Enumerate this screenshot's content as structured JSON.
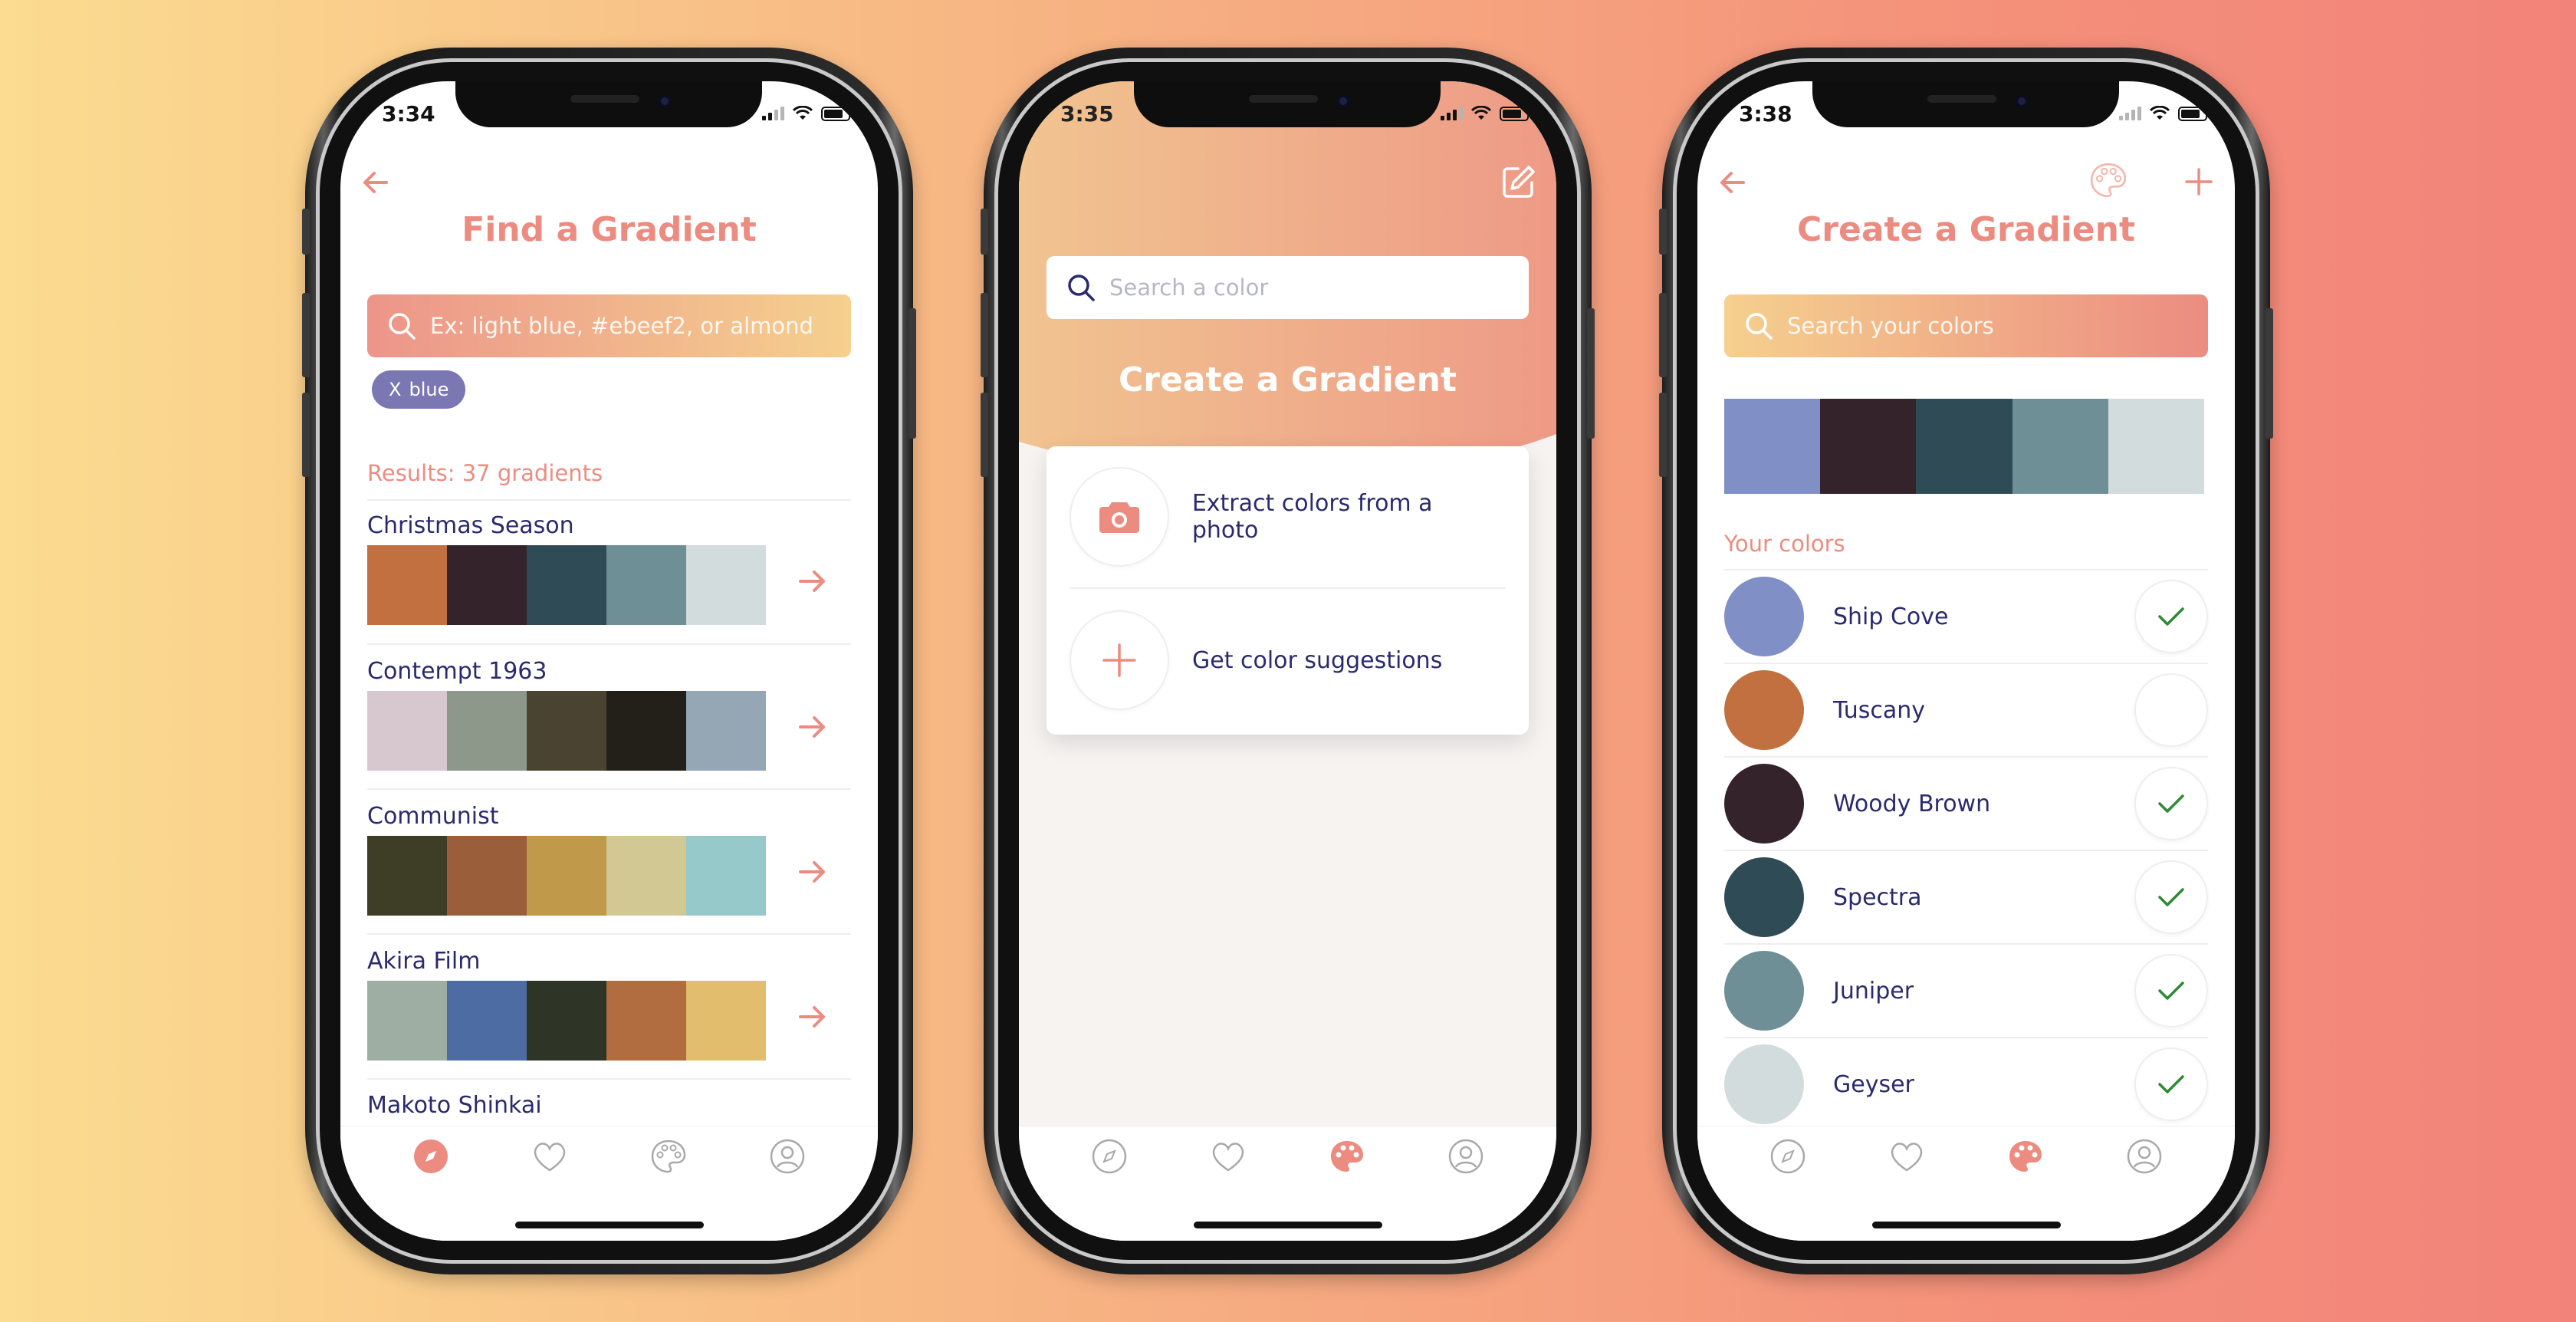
{
  "colors": {
    "accent": "#ec8c81",
    "navy": "#2a2a6e",
    "chip": "#7b77b2"
  },
  "phone1": {
    "time": "3:34",
    "title": "Find a Gradient",
    "search_placeholder": "Ex: light blue, #ebeef2, or almond",
    "chip_x": "X",
    "chip_label": "blue",
    "results_label": "Results: 37 gradients",
    "gradients": [
      {
        "name": "Christmas Season",
        "colors": [
          "#c2703f",
          "#35232c",
          "#2f4b56",
          "#6e8f95",
          "#d2dcdd"
        ]
      },
      {
        "name": "Contempt 1963",
        "colors": [
          "#d7c8d0",
          "#8d978a",
          "#4a4331",
          "#231f19",
          "#95a6b4"
        ]
      },
      {
        "name": "Communist",
        "colors": [
          "#3e3e27",
          "#9b5e3a",
          "#c09a4a",
          "#d2c893",
          "#96c9c9"
        ]
      },
      {
        "name": "Akira Film",
        "colors": [
          "#9eaea3",
          "#4c6ca3",
          "#2e3527",
          "#b16d3f",
          "#e1bd6d"
        ]
      },
      {
        "name": "Makoto Shinkai",
        "colors": []
      }
    ],
    "tabs": [
      "compass-icon",
      "heart-icon",
      "palette-icon",
      "profile-icon"
    ],
    "active_tab": 0
  },
  "phone2": {
    "time": "3:35",
    "search_placeholder": "Search a color",
    "title": "Create a Gradient",
    "options": [
      {
        "icon": "camera-icon",
        "label": "Extract colors from a photo"
      },
      {
        "icon": "plus-icon",
        "label": "Get color suggestions"
      }
    ],
    "tabs": [
      "compass-icon",
      "heart-icon",
      "palette-icon",
      "profile-icon"
    ],
    "active_tab": 2
  },
  "phone3": {
    "time": "3:38",
    "title": "Create a Gradient",
    "search_placeholder": "Search your colors",
    "palette": [
      "#8090c6",
      "#35232c",
      "#2f4b56",
      "#6e8f95",
      "#d2dcdd"
    ],
    "section_label": "Your colors",
    "colors": [
      {
        "name": "Ship Cove",
        "hex": "#8090c6",
        "checked": true
      },
      {
        "name": "Tuscany",
        "hex": "#c2703f",
        "checked": false
      },
      {
        "name": "Woody Brown",
        "hex": "#35232c",
        "checked": true
      },
      {
        "name": "Spectra",
        "hex": "#2f4b56",
        "checked": true
      },
      {
        "name": "Juniper",
        "hex": "#6e8f95",
        "checked": true
      },
      {
        "name": "Geyser",
        "hex": "#d2dcdd",
        "checked": true
      }
    ],
    "tabs": [
      "compass-icon",
      "heart-icon",
      "palette-icon",
      "profile-icon"
    ],
    "active_tab": 2
  }
}
